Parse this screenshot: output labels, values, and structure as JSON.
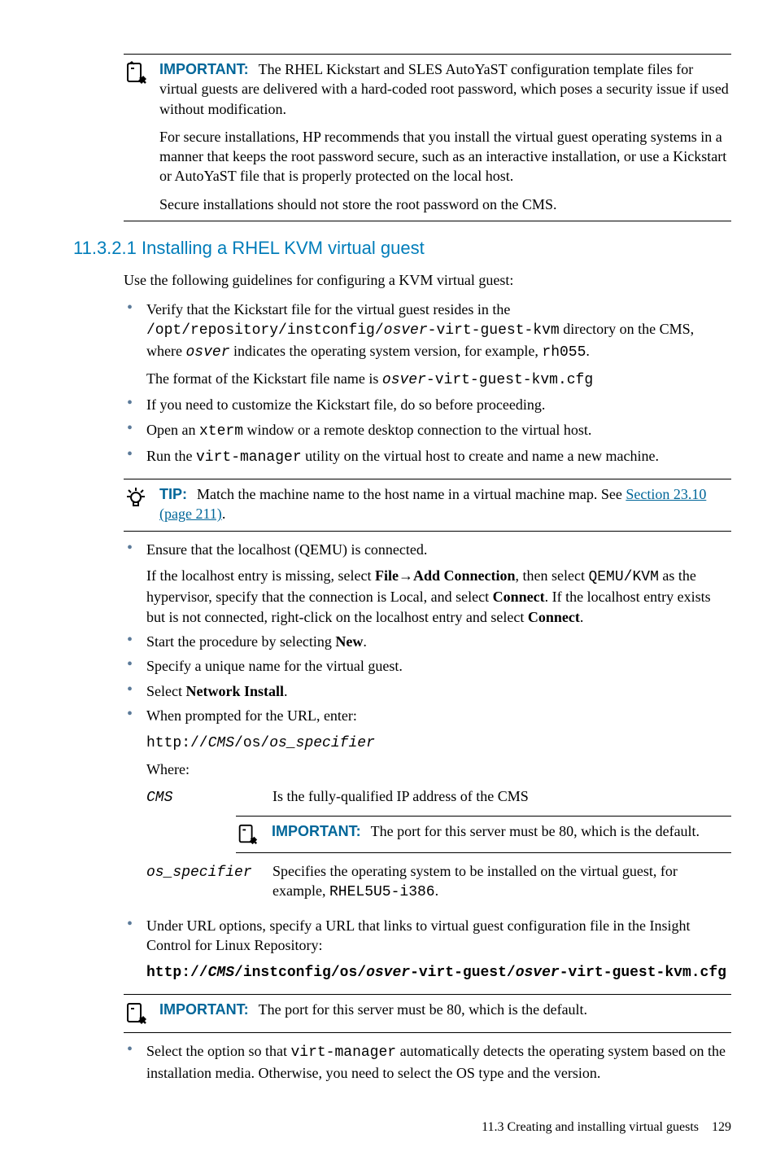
{
  "callout1": {
    "label": "IMPORTANT:",
    "p1": "The RHEL Kickstart and SLES AutoYaST configuration template files for virtual guests are delivered with a hard-coded root password, which poses a security issue if used without modification.",
    "p2": "For secure installations, HP recommends that you install the virtual guest operating systems in a manner that keeps the root password secure, such as an interactive installation, or use a Kickstart or AutoYaST file that is properly protected on the local host.",
    "p3": "Secure installations should not store the root password on the CMS."
  },
  "section": {
    "number": "11.3.2.1",
    "title": "Installing a RHEL KVM virtual guest"
  },
  "intro": "Use the following guidelines for configuring a KVM virtual guest:",
  "b1": {
    "pre": "Verify that the Kickstart file for the virtual guest resides in the ",
    "path_pre": "/opt/repository/instconfig/",
    "path_var": "osver",
    "path_post": "-virt-guest-kvm",
    "after_path": " directory on the CMS, where ",
    "osver_var": "osver",
    "after_osver": " indicates the operating system version, for example, ",
    "example": "rh055",
    "period": ".",
    "format_pre": "The format of the Kickstart file name is ",
    "fmt_var": "osver",
    "fmt_post": "-virt-guest-kvm.cfg"
  },
  "b2": "If you need to customize the Kickstart file, do so before proceeding.",
  "b3": {
    "pre": "Open an ",
    "cmd": "xterm",
    "post": " window or a remote desktop connection to the virtual host."
  },
  "b4": {
    "pre": "Run the ",
    "cmd": "virt-manager",
    "post": " utility on the virtual host to create and name a new machine."
  },
  "tip": {
    "label": "TIP:",
    "pre": "Match the machine name to the host name in a virtual machine map. See ",
    "link": "Section 23.10 (page 211)",
    "post": "."
  },
  "b5": {
    "p1": "Ensure that the localhost (QEMU) is connected.",
    "p2_pre": "If the localhost entry is missing, select ",
    "file": "File",
    "arrow": "→",
    "addconn": "Add Connection",
    "p2_mid1": ", then select ",
    "qemu": "QEMU/KVM",
    "p2_mid2": " as the hypervisor, specify that the connection is Local, and select ",
    "connect": "Connect",
    "p2_mid3": ". If the localhost entry exists but is not connected, right-click on the localhost entry and select ",
    "connect2": "Connect",
    "p2_end": "."
  },
  "b6": {
    "pre": "Start the procedure by selecting ",
    "new": "New",
    "post": "."
  },
  "b7": "Specify a unique name for the virtual guest.",
  "b8": {
    "pre": "Select ",
    "ni": "Network Install",
    "post": "."
  },
  "b9": {
    "p1": "When prompted for the URL, enter:",
    "url_pre": "http://",
    "url_cms": "CMS",
    "url_mid": "/os/",
    "url_spec": "os_specifier",
    "where": "Where:"
  },
  "wh_cms_term": "CMS",
  "wh_cms_def": "Is the fully-qualified IP address of the CMS",
  "callout2": {
    "label": "IMPORTANT:",
    "text": "The port for this server must be 80, which is the default."
  },
  "wh_spec_term": "os_specifier",
  "wh_spec_def_pre": "Specifies the operating system to be installed on the virtual guest, for example, ",
  "wh_spec_example": "RHEL5U5-i386",
  "wh_spec_def_post": ".",
  "b10": {
    "p1": "Under URL options, specify a URL that links to virtual guest configuration file in the Insight Control for Linux Repository:",
    "url_1": "http://",
    "url_cms": "CMS",
    "url_2": "/instconfig/os/",
    "url_osver1": "osver",
    "url_3": "-virt-guest/",
    "url_osver2": "osver",
    "url_4": "-virt-guest-kvm.cfg"
  },
  "callout3": {
    "label": "IMPORTANT:",
    "text": "The port for this server must be 80, which is the default."
  },
  "b11": {
    "pre": "Select the option so that ",
    "cmd": "virt-manager",
    "post": " automatically detects the operating system based on the installation media. Otherwise, you need to select the OS type and the version."
  },
  "footer": {
    "section": "11.3 Creating and installing virtual guests",
    "page": "129"
  }
}
